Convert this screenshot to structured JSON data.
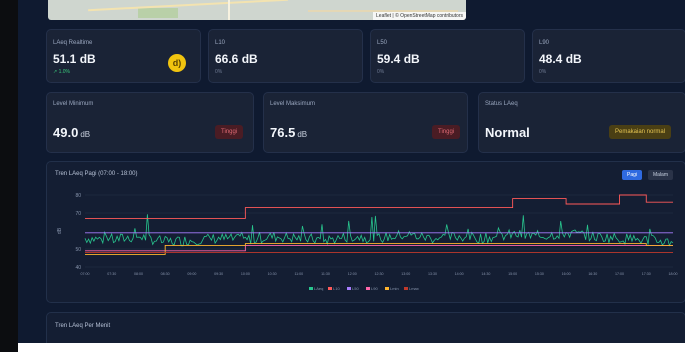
{
  "map": {
    "attribution": "Leaflet | © OpenStreetMap contributors"
  },
  "stats": [
    {
      "label": "LAeq Realtime",
      "value": "51.1 dB",
      "sub": "↗ 1.0%"
    },
    {
      "label": "L10",
      "value": "66.6 dB",
      "sub": "0%"
    },
    {
      "label": "L50",
      "value": "59.4 dB",
      "sub": "0%"
    },
    {
      "label": "L90",
      "value": "48.4 dB",
      "sub": "0%"
    }
  ],
  "realtime_icon": "d)",
  "levels": {
    "min": {
      "label": "Level Minimum",
      "value": "49.0",
      "unit": "dB",
      "tag": "Tinggi"
    },
    "max": {
      "label": "Level Maksimum",
      "value": "76.5",
      "unit": "dB",
      "tag": "Tinggi"
    },
    "status": {
      "label": "Status LAeq",
      "value": "Normal",
      "tag": "Pemakaian normal"
    }
  },
  "chart": {
    "title": "Tren LAeq Pagi (07:00 - 18:00)",
    "toggle_on": "Pagi",
    "toggle_off": "Malam"
  },
  "chart_data": {
    "type": "line",
    "ylabel": "dB",
    "ylim": [
      40,
      80
    ],
    "yticks": [
      40,
      50,
      70,
      80
    ],
    "xticks": [
      "07:00",
      "07:30",
      "08:00",
      "08:30",
      "09:00",
      "09:30",
      "10:00",
      "10:30",
      "11:00",
      "11:30",
      "12:00",
      "12:30",
      "13:00",
      "13:30",
      "14:00",
      "14:30",
      "15:00",
      "15:30",
      "16:00",
      "16:30",
      "17:00",
      "17:30",
      "18:00"
    ],
    "series": [
      {
        "name": "LAeq",
        "color": "#28c58e",
        "values": [
          56,
          55,
          57,
          54,
          55,
          56,
          55,
          57,
          56,
          55,
          57,
          56,
          58,
          56,
          57,
          56,
          58,
          57,
          59,
          57,
          56,
          55,
          54
        ]
      },
      {
        "name": "L10",
        "color": "#ff5a5a",
        "values": [
          67,
          67,
          67,
          67,
          67,
          67,
          73,
          73,
          73,
          73,
          73,
          73,
          73,
          73,
          73,
          73,
          78,
          78,
          75,
          75,
          80,
          76,
          76
        ]
      },
      {
        "name": "L50",
        "color": "#a77dff",
        "values": [
          59,
          59,
          59,
          59,
          59,
          59,
          59,
          59,
          59,
          59,
          59,
          59,
          59,
          59,
          59,
          59,
          59,
          59,
          59,
          59,
          59,
          59,
          59
        ]
      },
      {
        "name": "L90",
        "color": "#ff66aa",
        "values": [
          49,
          49,
          49,
          49,
          49,
          49,
          52,
          52,
          52,
          52,
          52,
          52,
          52,
          52,
          52,
          52,
          52,
          52,
          52,
          52,
          52,
          52,
          52
        ]
      },
      {
        "name": "Lmin",
        "color": "#ffb52e",
        "values": [
          47,
          47,
          47,
          52,
          52,
          52,
          53,
          53,
          53,
          53,
          53,
          53,
          53,
          53,
          53,
          53,
          53,
          53,
          53,
          53,
          53,
          52,
          52
        ]
      },
      {
        "name": "Lmax",
        "color": "#c0392b",
        "values": [
          48,
          48,
          48,
          48,
          48,
          48,
          48,
          48,
          48,
          48,
          48,
          48,
          48,
          48,
          48,
          48,
          48,
          48,
          48,
          48,
          48,
          48,
          48
        ]
      }
    ]
  },
  "legend": [
    "LAeq",
    "L10",
    "L50",
    "L90",
    "Lmin",
    "Lmax"
  ],
  "bottom_chart": {
    "title": "Tren LAeq Per Menit"
  }
}
